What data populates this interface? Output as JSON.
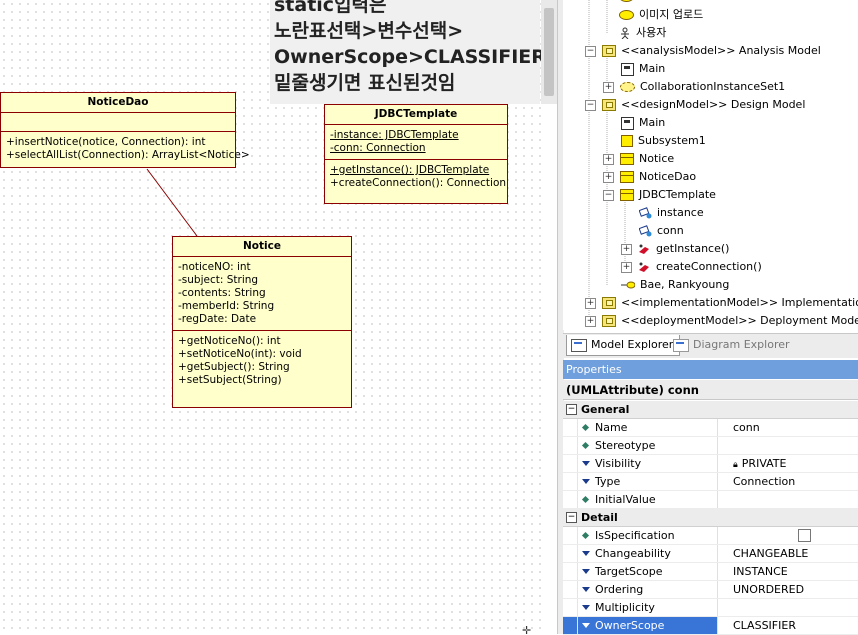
{
  "note": {
    "lines": [
      "static입력은",
      "노란표선택>변수선택>",
      "OwnerScope>CLASSIFIER선택",
      "밑줄생기면 표신된것임"
    ]
  },
  "classes": {
    "noticedao": {
      "name": "NoticeDao",
      "attributes": [],
      "operations": [
        "+insertNotice(notice, Connection): int",
        "+selectAllList(Connection): ArrayList<Notice>"
      ]
    },
    "jdbc": {
      "name": "JDBCTemplate",
      "attributes": [
        "-instance: JDBCTemplate",
        "-conn: Connection"
      ],
      "operations": [
        "+getInstance(): JDBCTemplate",
        "+createConnection(): Connection"
      ]
    },
    "notice": {
      "name": "Notice",
      "attributes": [
        "-noticeNO: int",
        "-subject: String",
        "-contents: String",
        "-memberId: String",
        "-regDate: Date"
      ],
      "operations": [
        "+getNoticeNo(): int",
        "+setNoticeNo(int): void",
        "+getSubject(): String",
        "+setSubject(String)"
      ]
    }
  },
  "tree": {
    "items": [
      "이미지 업로드",
      "사용자",
      "<<analysisModel>> Analysis Model",
      "Main",
      "CollaborationInstanceSet1",
      "<<designModel>> Design Model",
      "Main",
      "Subsystem1",
      "Notice",
      "NoticeDao",
      "JDBCTemplate",
      "instance",
      "conn",
      "getInstance()",
      "createConnection()",
      "Bae, Rankyoung",
      "<<implementationModel>> Implementation Model",
      "<<deploymentModel>> Deployment Model"
    ]
  },
  "tabs": {
    "model_explorer": "Model Explorer",
    "diagram_explorer": "Diagram Explorer"
  },
  "properties": {
    "header": "Properties",
    "selected": "(UMLAttribute) conn",
    "general_label": "General",
    "detail_label": "Detail",
    "general": [
      {
        "name": "Name",
        "value": "conn"
      },
      {
        "name": "Stereotype",
        "value": ""
      },
      {
        "name": "Visibility",
        "value": "PRIVATE"
      },
      {
        "name": "Type",
        "value": "Connection"
      },
      {
        "name": "InitialValue",
        "value": ""
      }
    ],
    "detail": [
      {
        "name": "IsSpecification",
        "value": ""
      },
      {
        "name": "Changeability",
        "value": "CHANGEABLE"
      },
      {
        "name": "TargetScope",
        "value": "INSTANCE"
      },
      {
        "name": "Ordering",
        "value": "UNORDERED"
      },
      {
        "name": "Multiplicity",
        "value": ""
      },
      {
        "name": "OwnerScope",
        "value": "CLASSIFIER"
      }
    ]
  },
  "colors": {
    "class_fill": "#ffffcc",
    "class_border": "#8b0000",
    "selection": "#3875d7",
    "props_header": "#6f9fdc"
  }
}
